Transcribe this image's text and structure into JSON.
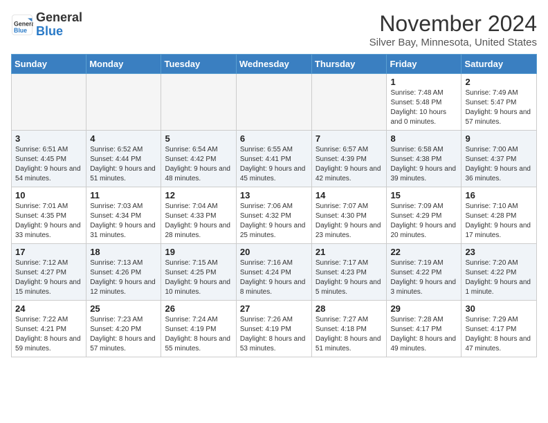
{
  "header": {
    "logo_general": "General",
    "logo_blue": "Blue",
    "month_title": "November 2024",
    "location": "Silver Bay, Minnesota, United States"
  },
  "calendar": {
    "days_of_week": [
      "Sunday",
      "Monday",
      "Tuesday",
      "Wednesday",
      "Thursday",
      "Friday",
      "Saturday"
    ],
    "weeks": [
      [
        {
          "day": "",
          "empty": true
        },
        {
          "day": "",
          "empty": true
        },
        {
          "day": "",
          "empty": true
        },
        {
          "day": "",
          "empty": true
        },
        {
          "day": "",
          "empty": true
        },
        {
          "day": "1",
          "sunrise": "Sunrise: 7:48 AM",
          "sunset": "Sunset: 5:48 PM",
          "daylight": "Daylight: 10 hours and 0 minutes."
        },
        {
          "day": "2",
          "sunrise": "Sunrise: 7:49 AM",
          "sunset": "Sunset: 5:47 PM",
          "daylight": "Daylight: 9 hours and 57 minutes."
        }
      ],
      [
        {
          "day": "3",
          "sunrise": "Sunrise: 6:51 AM",
          "sunset": "Sunset: 4:45 PM",
          "daylight": "Daylight: 9 hours and 54 minutes."
        },
        {
          "day": "4",
          "sunrise": "Sunrise: 6:52 AM",
          "sunset": "Sunset: 4:44 PM",
          "daylight": "Daylight: 9 hours and 51 minutes."
        },
        {
          "day": "5",
          "sunrise": "Sunrise: 6:54 AM",
          "sunset": "Sunset: 4:42 PM",
          "daylight": "Daylight: 9 hours and 48 minutes."
        },
        {
          "day": "6",
          "sunrise": "Sunrise: 6:55 AM",
          "sunset": "Sunset: 4:41 PM",
          "daylight": "Daylight: 9 hours and 45 minutes."
        },
        {
          "day": "7",
          "sunrise": "Sunrise: 6:57 AM",
          "sunset": "Sunset: 4:39 PM",
          "daylight": "Daylight: 9 hours and 42 minutes."
        },
        {
          "day": "8",
          "sunrise": "Sunrise: 6:58 AM",
          "sunset": "Sunset: 4:38 PM",
          "daylight": "Daylight: 9 hours and 39 minutes."
        },
        {
          "day": "9",
          "sunrise": "Sunrise: 7:00 AM",
          "sunset": "Sunset: 4:37 PM",
          "daylight": "Daylight: 9 hours and 36 minutes."
        }
      ],
      [
        {
          "day": "10",
          "sunrise": "Sunrise: 7:01 AM",
          "sunset": "Sunset: 4:35 PM",
          "daylight": "Daylight: 9 hours and 33 minutes."
        },
        {
          "day": "11",
          "sunrise": "Sunrise: 7:03 AM",
          "sunset": "Sunset: 4:34 PM",
          "daylight": "Daylight: 9 hours and 31 minutes."
        },
        {
          "day": "12",
          "sunrise": "Sunrise: 7:04 AM",
          "sunset": "Sunset: 4:33 PM",
          "daylight": "Daylight: 9 hours and 28 minutes."
        },
        {
          "day": "13",
          "sunrise": "Sunrise: 7:06 AM",
          "sunset": "Sunset: 4:32 PM",
          "daylight": "Daylight: 9 hours and 25 minutes."
        },
        {
          "day": "14",
          "sunrise": "Sunrise: 7:07 AM",
          "sunset": "Sunset: 4:30 PM",
          "daylight": "Daylight: 9 hours and 23 minutes."
        },
        {
          "day": "15",
          "sunrise": "Sunrise: 7:09 AM",
          "sunset": "Sunset: 4:29 PM",
          "daylight": "Daylight: 9 hours and 20 minutes."
        },
        {
          "day": "16",
          "sunrise": "Sunrise: 7:10 AM",
          "sunset": "Sunset: 4:28 PM",
          "daylight": "Daylight: 9 hours and 17 minutes."
        }
      ],
      [
        {
          "day": "17",
          "sunrise": "Sunrise: 7:12 AM",
          "sunset": "Sunset: 4:27 PM",
          "daylight": "Daylight: 9 hours and 15 minutes."
        },
        {
          "day": "18",
          "sunrise": "Sunrise: 7:13 AM",
          "sunset": "Sunset: 4:26 PM",
          "daylight": "Daylight: 9 hours and 12 minutes."
        },
        {
          "day": "19",
          "sunrise": "Sunrise: 7:15 AM",
          "sunset": "Sunset: 4:25 PM",
          "daylight": "Daylight: 9 hours and 10 minutes."
        },
        {
          "day": "20",
          "sunrise": "Sunrise: 7:16 AM",
          "sunset": "Sunset: 4:24 PM",
          "daylight": "Daylight: 9 hours and 8 minutes."
        },
        {
          "day": "21",
          "sunrise": "Sunrise: 7:17 AM",
          "sunset": "Sunset: 4:23 PM",
          "daylight": "Daylight: 9 hours and 5 minutes."
        },
        {
          "day": "22",
          "sunrise": "Sunrise: 7:19 AM",
          "sunset": "Sunset: 4:22 PM",
          "daylight": "Daylight: 9 hours and 3 minutes."
        },
        {
          "day": "23",
          "sunrise": "Sunrise: 7:20 AM",
          "sunset": "Sunset: 4:22 PM",
          "daylight": "Daylight: 9 hours and 1 minute."
        }
      ],
      [
        {
          "day": "24",
          "sunrise": "Sunrise: 7:22 AM",
          "sunset": "Sunset: 4:21 PM",
          "daylight": "Daylight: 8 hours and 59 minutes."
        },
        {
          "day": "25",
          "sunrise": "Sunrise: 7:23 AM",
          "sunset": "Sunset: 4:20 PM",
          "daylight": "Daylight: 8 hours and 57 minutes."
        },
        {
          "day": "26",
          "sunrise": "Sunrise: 7:24 AM",
          "sunset": "Sunset: 4:19 PM",
          "daylight": "Daylight: 8 hours and 55 minutes."
        },
        {
          "day": "27",
          "sunrise": "Sunrise: 7:26 AM",
          "sunset": "Sunset: 4:19 PM",
          "daylight": "Daylight: 8 hours and 53 minutes."
        },
        {
          "day": "28",
          "sunrise": "Sunrise: 7:27 AM",
          "sunset": "Sunset: 4:18 PM",
          "daylight": "Daylight: 8 hours and 51 minutes."
        },
        {
          "day": "29",
          "sunrise": "Sunrise: 7:28 AM",
          "sunset": "Sunset: 4:17 PM",
          "daylight": "Daylight: 8 hours and 49 minutes."
        },
        {
          "day": "30",
          "sunrise": "Sunrise: 7:29 AM",
          "sunset": "Sunset: 4:17 PM",
          "daylight": "Daylight: 8 hours and 47 minutes."
        }
      ]
    ]
  }
}
